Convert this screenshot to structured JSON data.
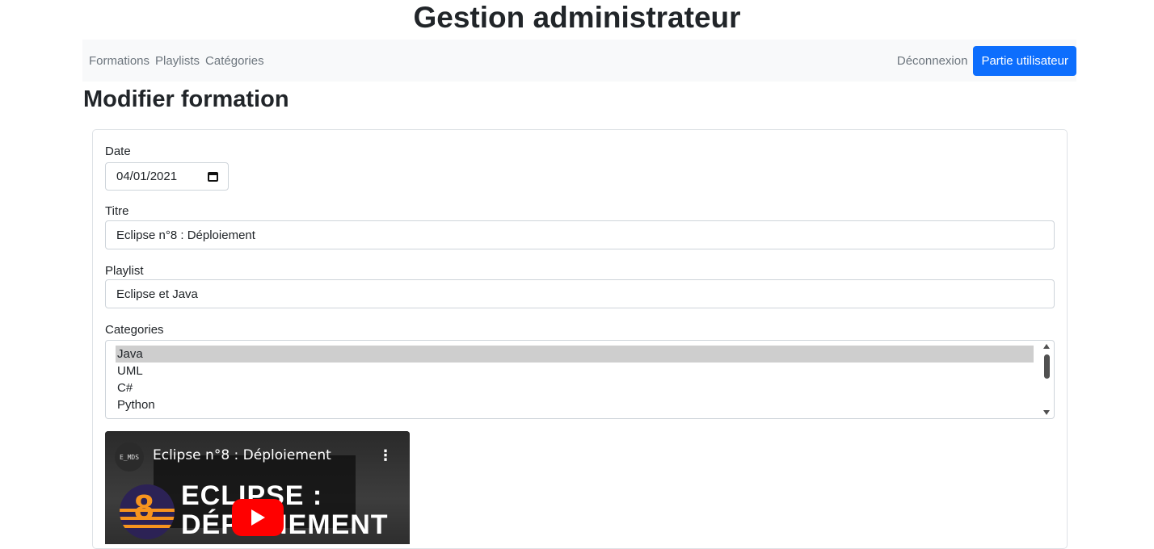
{
  "header": {
    "title": "Gestion administrateur"
  },
  "navbar": {
    "links": [
      "Formations",
      "Playlists",
      "Catégories"
    ],
    "logout_label": "Déconnexion",
    "user_button_label": "Partie utilisateur"
  },
  "form": {
    "section_title": "Modifier formation",
    "date": {
      "label": "Date",
      "value": "04/01/2021"
    },
    "title": {
      "label": "Titre",
      "value": "Eclipse n°8 : Déploiement"
    },
    "playlist": {
      "label": "Playlist",
      "value": "Eclipse et Java"
    },
    "categories": {
      "label": "Categories",
      "options": [
        "Java",
        "UML",
        "C#",
        "Python"
      ],
      "selected": "Java"
    }
  },
  "video": {
    "channel_avatar": "E_MDS",
    "title": "Eclipse n°8 : Déploiement",
    "menu_icon": "⋮",
    "thumbnail_number": "8",
    "thumbnail_text": "ECLIPSE :\nDÉPLOIEMENT"
  },
  "colors": {
    "accent": "#0d6efd",
    "nav_background": "#f8f9fa",
    "selected_option": "#cecece",
    "youtube_red": "#ff0000"
  }
}
